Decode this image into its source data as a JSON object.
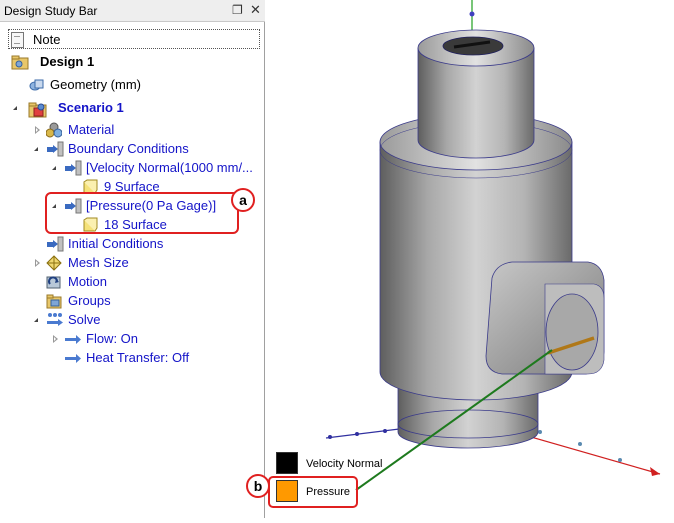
{
  "panel": {
    "title": "Design Study Bar",
    "pin_glyph": "❐",
    "close_glyph": "✕",
    "note": "Note"
  },
  "tree": {
    "design": "Design 1",
    "geometry": "Geometry (mm)",
    "scenario": "Scenario 1",
    "material": "Material",
    "boundary_conditions": "Boundary Conditions",
    "velocity_bc": "[Velocity Normal(1000 mm/...",
    "velocity_surface": "9 Surface",
    "pressure_bc": "[Pressure(0 Pa Gage)]",
    "pressure_surface": "18 Surface",
    "initial_conditions": "Initial Conditions",
    "mesh_size": "Mesh Size",
    "motion": "Motion",
    "groups": "Groups",
    "solve": "Solve",
    "flow": "Flow: On",
    "heat_transfer": "Heat Transfer: Off"
  },
  "callouts": {
    "a": "a",
    "b": "b"
  },
  "legend": {
    "items": [
      {
        "label": "Velocity Normal",
        "color": "#000000"
      },
      {
        "label": "Pressure",
        "color": "#ff9900"
      }
    ]
  },
  "colors": {
    "highlight": "#e02020",
    "leader": "#1e7a1e",
    "link_blue": "#1414c8"
  }
}
